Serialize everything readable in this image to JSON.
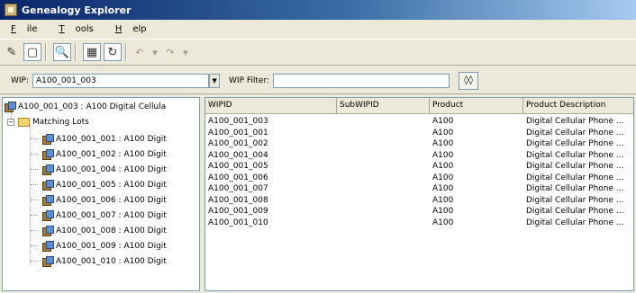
{
  "window": {
    "title": "Genealogy Explorer"
  },
  "menu": [
    {
      "first": "F",
      "rest": "ile"
    },
    {
      "first": "T",
      "rest": "ools"
    },
    {
      "first": "H",
      "rest": "elp"
    }
  ],
  "toolbar": {
    "icons": [
      "eraser-icon",
      "panel-icon",
      "print-preview-icon",
      "columns-icon",
      "refresh-icon",
      "undo-icon",
      "dropdown-icon",
      "redo-icon",
      "dropdown-icon"
    ]
  },
  "filter": {
    "wip_label": "WIP:",
    "wip_value": "A100_001_003",
    "wip_filter_label": "WIP Filter:",
    "wip_filter_value": ""
  },
  "tree": {
    "root": "A100_001_003 : A100 Digital Cellula",
    "folder": "Matching Lots",
    "items": [
      "A100_001_001 : A100 Digit",
      "A100_001_002 : A100 Digit",
      "A100_001_004 : A100 Digit",
      "A100_001_005 : A100 Digit",
      "A100_001_006 : A100 Digit",
      "A100_001_007 : A100 Digit",
      "A100_001_008 : A100 Digit",
      "A100_001_009 : A100 Digit",
      "A100_001_010 : A100 Digit"
    ]
  },
  "grid": {
    "columns": [
      "WIPID",
      "SubWIPID",
      "Product",
      "Product Description"
    ],
    "rows": [
      [
        "A100_001_003",
        "",
        "A100",
        "Digital Cellular Phone ..."
      ],
      [
        "A100_001_001",
        "",
        "A100",
        "Digital Cellular Phone ..."
      ],
      [
        "A100_001_002",
        "",
        "A100",
        "Digital Cellular Phone ..."
      ],
      [
        "A100_001_004",
        "",
        "A100",
        "Digital Cellular Phone ..."
      ],
      [
        "A100_001_005",
        "",
        "A100",
        "Digital Cellular Phone ..."
      ],
      [
        "A100_001_006",
        "",
        "A100",
        "Digital Cellular Phone ..."
      ],
      [
        "A100_001_007",
        "",
        "A100",
        "Digital Cellular Phone ..."
      ],
      [
        "A100_001_008",
        "",
        "A100",
        "Digital Cellular Phone ..."
      ],
      [
        "A100_001_009",
        "",
        "A100",
        "Digital Cellular Phone ..."
      ],
      [
        "A100_001_010",
        "",
        "A100",
        "Digital Cellular Phone ..."
      ]
    ]
  }
}
